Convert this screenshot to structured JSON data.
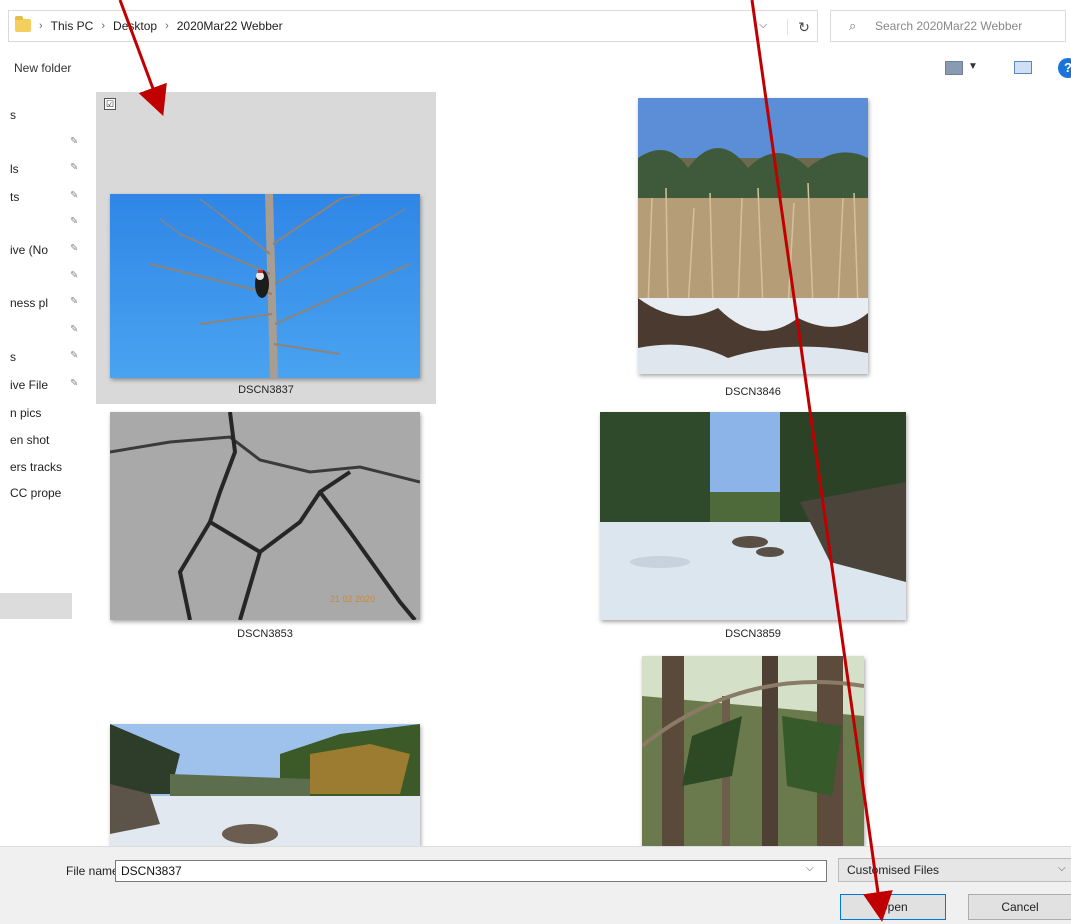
{
  "address": {
    "breadcrumbs": [
      "This PC",
      "Desktop",
      "2020Mar22 Webber"
    ],
    "separator": "›",
    "refresh_icon": "↻"
  },
  "search": {
    "placeholder": "Search 2020Mar22 Webber"
  },
  "toolbar": {
    "new_folder": "New folder",
    "help": "?"
  },
  "sidebar": {
    "items": [
      {
        "label": "s",
        "pinned": false
      },
      {
        "label": "",
        "pinned": true
      },
      {
        "label": "ls",
        "pinned": true
      },
      {
        "label": "ts",
        "pinned": true
      },
      {
        "label": "",
        "pinned": true
      },
      {
        "label": "ive (No",
        "pinned": true
      },
      {
        "label": "",
        "pinned": true
      },
      {
        "label": "ness pl",
        "pinned": true
      },
      {
        "label": "",
        "pinned": true
      },
      {
        "label": "s",
        "pinned": true
      },
      {
        "label": "ive File",
        "pinned": true
      },
      {
        "label": "n pics",
        "pinned": false
      },
      {
        "label": "en shot",
        "pinned": false
      },
      {
        "label": "ers tracks",
        "pinned": false
      },
      {
        "label": "CC prope",
        "pinned": false
      }
    ],
    "pin_icon": "📌"
  },
  "files": [
    {
      "name": "DSCN3837",
      "selected": true,
      "checkbox": "☑"
    },
    {
      "name": "DSCN3846",
      "selected": false
    },
    {
      "name": "DSCN3853",
      "selected": false,
      "stamp": "21 02 2020"
    },
    {
      "name": "DSCN3859",
      "selected": false
    },
    {
      "name": "",
      "selected": false
    },
    {
      "name": "",
      "selected": false
    }
  ],
  "bottom": {
    "file_name_label": "File name:",
    "file_name_value": "DSCN3837",
    "file_type": "Customised Files",
    "open_label": "Open",
    "cancel_label": "Cancel",
    "dropdown_icon": "⌵"
  },
  "colors": {
    "annotation_arrow": "#c00000",
    "selection": "#d9d9d9",
    "accent": "#0078d7"
  }
}
